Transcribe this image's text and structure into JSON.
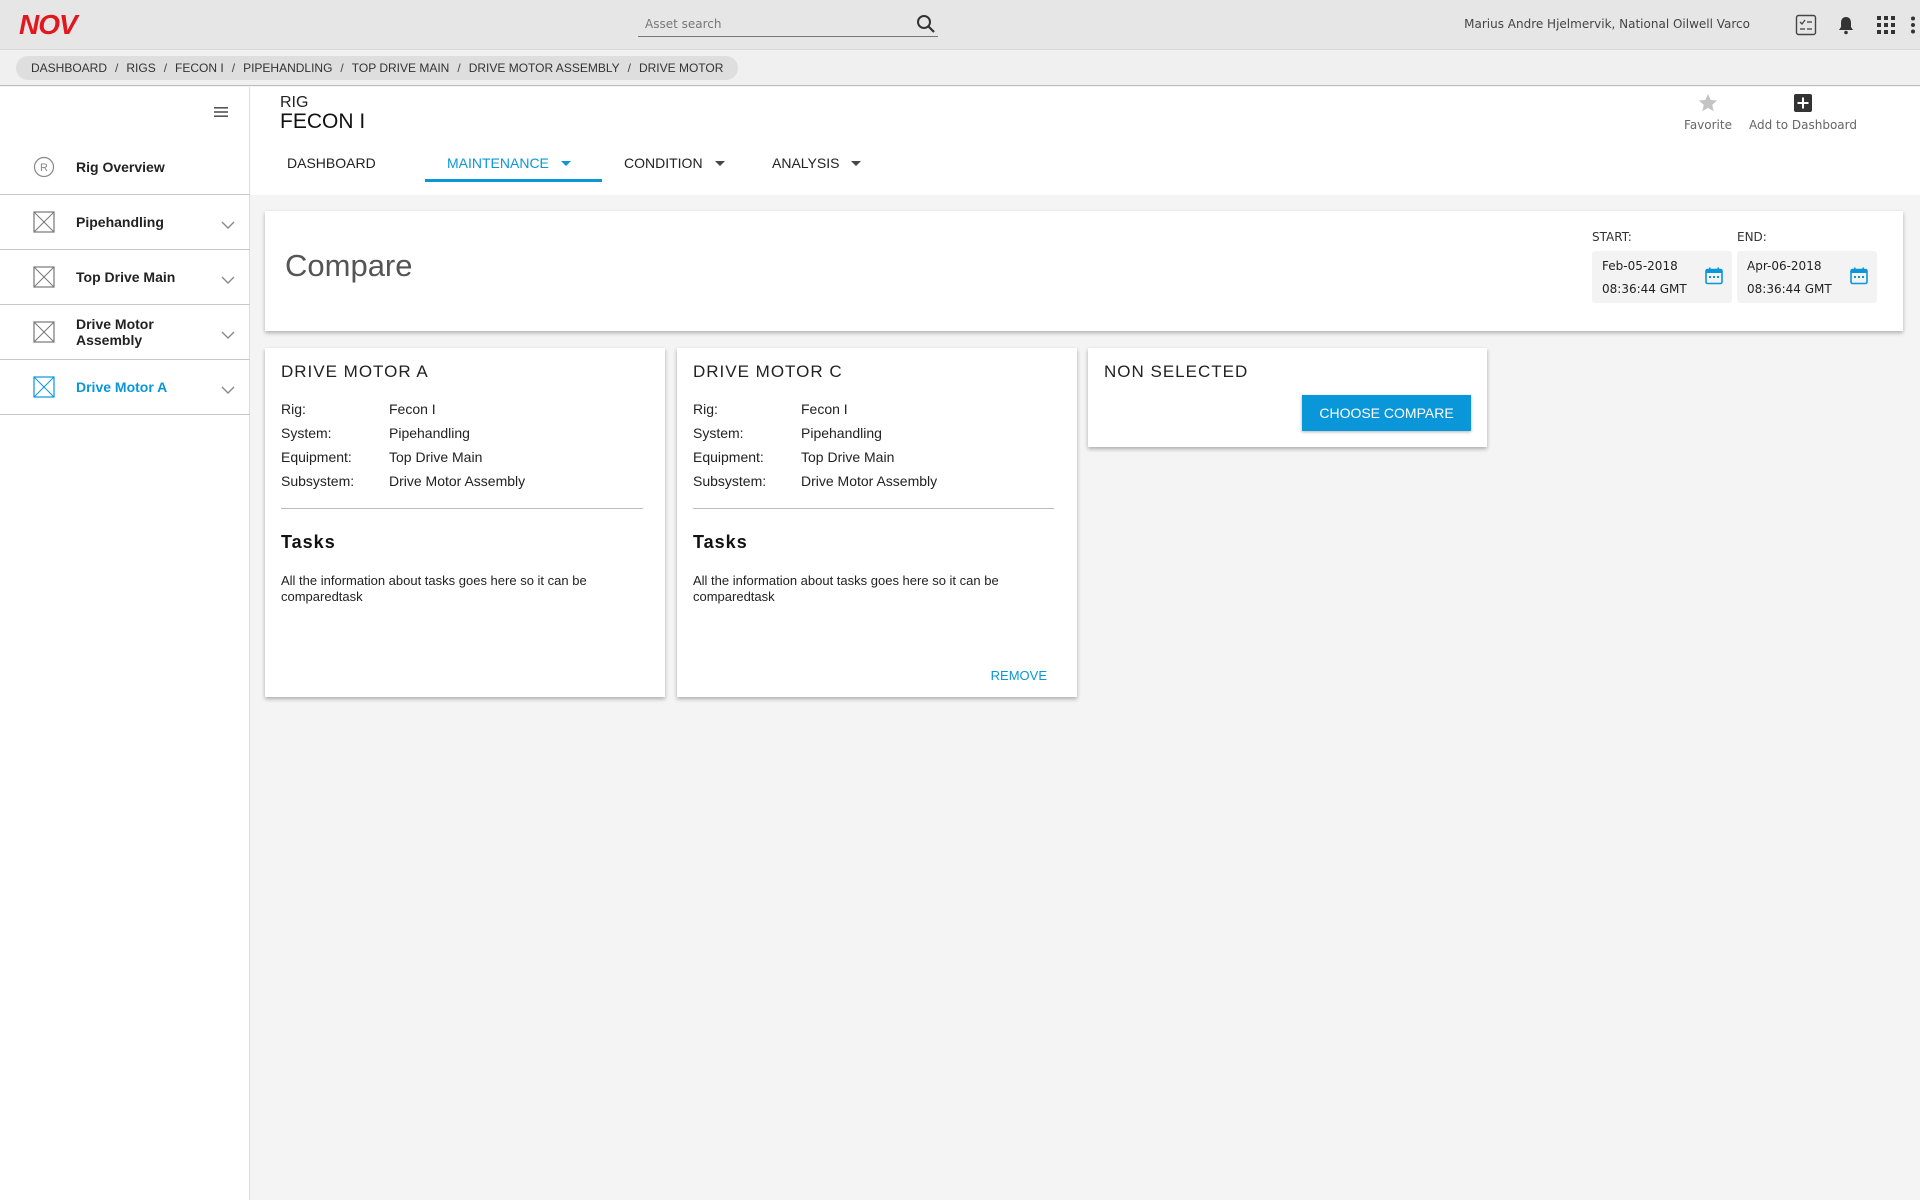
{
  "app": {
    "logo_text": "NOV",
    "search_placeholder": "Asset search",
    "user": "Marius Andre Hjelmervik, National Oilwell Varco",
    "icons": [
      "checklist-icon",
      "bell-icon",
      "apps-grid-icon",
      "more-vert-icon"
    ]
  },
  "breadcrumb": [
    "DASHBOARD",
    "RIGS",
    "FECON I",
    "PIPEHANDLING",
    "TOP DRIVE MAIN",
    "DRIVE MOTOR ASSEMBLY",
    "DRIVE MOTOR"
  ],
  "sidebar": {
    "items": [
      {
        "label": "Rig Overview",
        "icon": "rig-r-icon",
        "expandable": false,
        "active": false
      },
      {
        "label": "Pipehandling",
        "icon": "placeholder-x-icon",
        "expandable": true,
        "active": false
      },
      {
        "label": "Top Drive Main",
        "icon": "placeholder-x-icon",
        "expandable": true,
        "active": false
      },
      {
        "label": "Drive Motor Assembly",
        "icon": "placeholder-x-icon",
        "expandable": true,
        "active": false
      },
      {
        "label": "Drive Motor A",
        "icon": "placeholder-x-icon",
        "expandable": true,
        "active": true
      }
    ]
  },
  "header": {
    "rig_label": "RIG",
    "rig_name": "FECON I",
    "favorite_label": "Favorite",
    "add_dashboard_label": "Add to Dashboard",
    "tabs": [
      {
        "label": "DASHBOARD",
        "dropdown": false,
        "active": false
      },
      {
        "label": "MAINTENANCE",
        "dropdown": true,
        "active": true
      },
      {
        "label": "CONDITION",
        "dropdown": true,
        "active": false
      },
      {
        "label": "ANALYSIS",
        "dropdown": true,
        "active": false
      }
    ]
  },
  "compare": {
    "title": "Compare",
    "start_label": "START:",
    "start_date": "Feb-05-2018",
    "start_time": "08:36:44 GMT",
    "end_label": "END:",
    "end_date": "Apr-06-2018",
    "end_time": "08:36:44 GMT"
  },
  "cards": [
    {
      "title": "DRIVE MOTOR A",
      "meta": [
        {
          "k": "Rig:",
          "v": "Fecon I"
        },
        {
          "k": "System:",
          "v": "Pipehandling"
        },
        {
          "k": "Equipment:",
          "v": "Top Drive Main"
        },
        {
          "k": "Subsystem:",
          "v": "Drive Motor Assembly"
        }
      ],
      "tasks_heading": "Tasks",
      "tasks_text": "All the information about tasks goes here so it can be comparedtask"
    },
    {
      "title": "DRIVE MOTOR C",
      "meta": [
        {
          "k": "Rig:",
          "v": "Fecon I"
        },
        {
          "k": "System:",
          "v": "Pipehandling"
        },
        {
          "k": "Equipment:",
          "v": "Top Drive Main"
        },
        {
          "k": "Subsystem:",
          "v": "Drive Motor Assembly"
        }
      ],
      "tasks_heading": "Tasks",
      "tasks_text": "All the information about tasks goes here so it can be comparedtask",
      "remove_label": "REMOVE"
    },
    {
      "title": "NON SELECTED",
      "button_label": "CHOOSE COMPARE"
    }
  ],
  "colors": {
    "accent": "#0a97d9",
    "brand": "#e0191f"
  }
}
